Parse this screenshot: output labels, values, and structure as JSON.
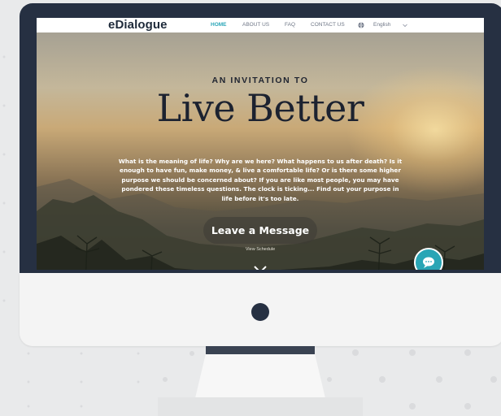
{
  "site": {
    "logo": "eDialogue",
    "nav": [
      {
        "label": "HOME",
        "active": true
      },
      {
        "label": "ABOUT US",
        "active": false
      },
      {
        "label": "FAQ",
        "active": false
      },
      {
        "label": "CONTACT US",
        "active": false
      }
    ],
    "language": "English"
  },
  "hero": {
    "kicker": "AN INVITATION TO",
    "title": "Live Better",
    "body": "What is the meaning of life? Why are we here? What happens to us after death? Is it enough to have fun, make money, & live a comfortable life? Or is there some higher purpose we should be concerned about? If you are like most people, you may have pondered these timeless questions. The clock is ticking... Find out your purpose in life before it's too late.",
    "cta": "Leave a Message",
    "secondary_link": "View Schedule"
  },
  "colors": {
    "accent": "#2aa6b8",
    "bar": "#6a3fa0",
    "frame": "#263042"
  },
  "icons": {
    "language": "globe-icon",
    "dropdown": "chevron-down-icon",
    "scroll": "chevron-down-icon",
    "chat": "chat-bubble-icon"
  }
}
